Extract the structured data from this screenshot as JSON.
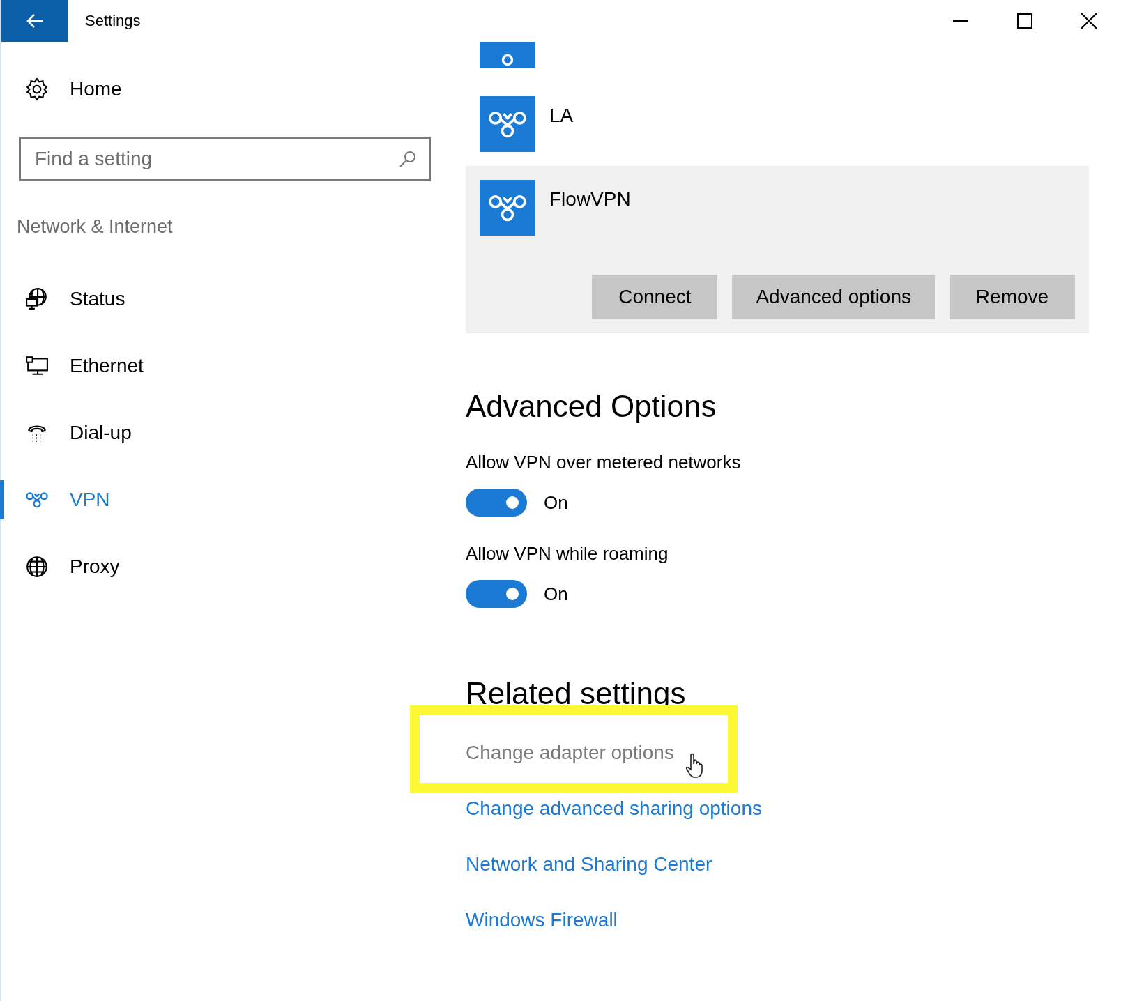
{
  "window": {
    "title": "Settings"
  },
  "sidebar": {
    "home": "Home",
    "search": {
      "placeholder": "Find a setting"
    },
    "section": "Network & Internet",
    "items": [
      {
        "kind": "status",
        "label": "Status",
        "selected": false
      },
      {
        "kind": "ethernet",
        "label": "Ethernet",
        "selected": false
      },
      {
        "kind": "dialup",
        "label": "Dial-up",
        "selected": false
      },
      {
        "kind": "vpn",
        "label": "VPN",
        "selected": true
      },
      {
        "kind": "proxy",
        "label": "Proxy",
        "selected": false
      }
    ]
  },
  "connections": [
    {
      "name": "LA",
      "selected": false
    },
    {
      "name": "FlowVPN",
      "selected": true,
      "buttons": [
        "Connect",
        "Advanced options",
        "Remove"
      ]
    }
  ],
  "advanced_options": {
    "heading": "Advanced Options",
    "toggles": [
      {
        "label": "Allow VPN over metered networks",
        "on": true,
        "state_text": "On"
      },
      {
        "label": "Allow VPN while roaming",
        "on": true,
        "state_text": "On"
      }
    ]
  },
  "related_settings": {
    "heading": "Related settings",
    "links": [
      {
        "label": "Change adapter options",
        "hovered": true,
        "highlighted": true
      },
      {
        "label": "Change advanced sharing options",
        "hovered": false,
        "highlighted": false
      },
      {
        "label": "Network and Sharing Center",
        "hovered": false,
        "highlighted": false
      },
      {
        "label": "Windows Firewall",
        "hovered": false,
        "highlighted": false
      }
    ]
  }
}
